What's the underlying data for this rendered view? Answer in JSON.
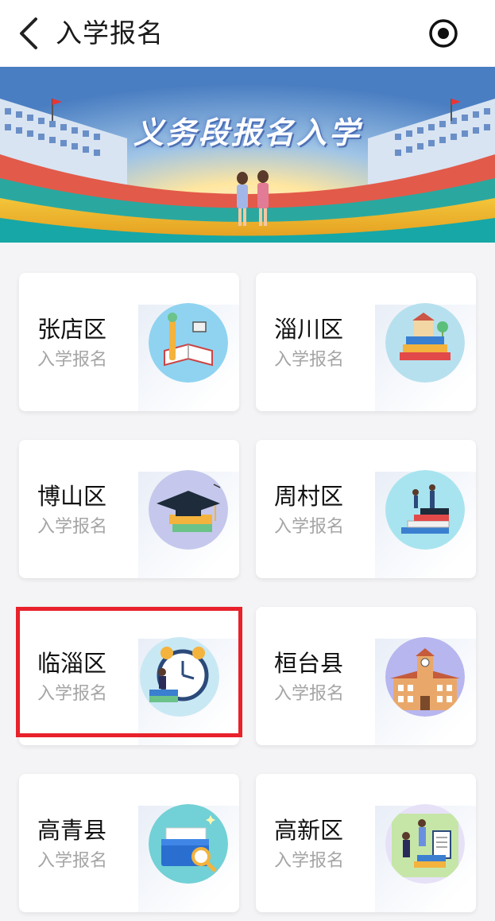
{
  "header": {
    "title": "入学报名",
    "back_icon": "chevron-left-icon",
    "action_icon": "target-icon"
  },
  "banner": {
    "title": "义务段报名入学"
  },
  "cards": [
    {
      "name": "张店区",
      "sub": "入学报名",
      "icon": "reading-book-icon",
      "icon_bg": "#8fd3f0"
    },
    {
      "name": "淄川区",
      "sub": "入学报名",
      "icon": "books-town-icon",
      "icon_bg": "#b7e0ee"
    },
    {
      "name": "博山区",
      "sub": "入学报名",
      "icon": "graduation-cap-icon",
      "icon_bg": "#c5c8ec"
    },
    {
      "name": "周村区",
      "sub": "入学报名",
      "icon": "book-stairs-icon",
      "icon_bg": "#a8e4ef"
    },
    {
      "name": "临淄区",
      "sub": "入学报名",
      "icon": "alarm-clock-icon",
      "icon_bg": "#c8e8f4"
    },
    {
      "name": "桓台县",
      "sub": "入学报名",
      "icon": "school-building-icon",
      "icon_bg": "#b7b6ef"
    },
    {
      "name": "高青县",
      "sub": "入学报名",
      "icon": "folder-search-icon",
      "icon_bg": "#71d1d6"
    },
    {
      "name": "高新区",
      "sub": "入学报名",
      "icon": "students-books-icon",
      "icon_bg": "#e7e1f7"
    }
  ],
  "colors": {
    "highlight": "#e8212b",
    "page_bg": "#f4f4f6"
  }
}
